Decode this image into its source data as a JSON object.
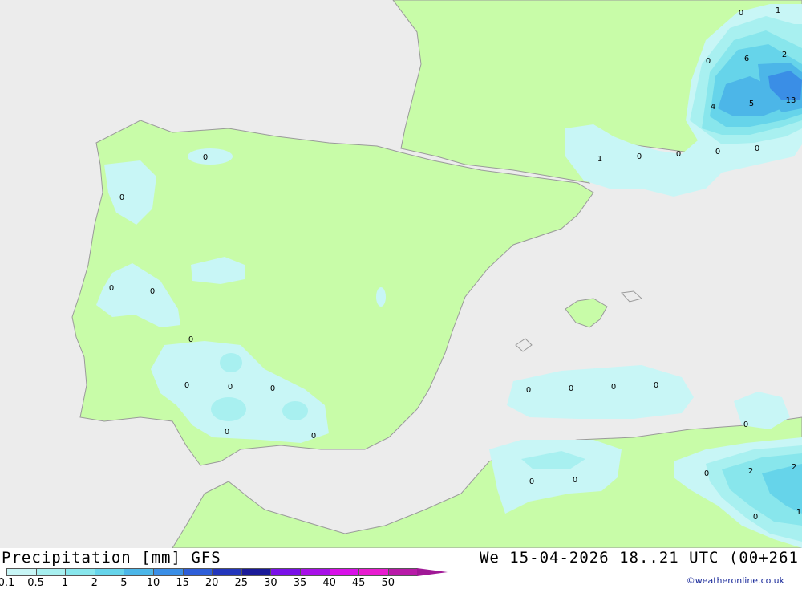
{
  "header": {
    "title": "Precipitation [mm] GFS",
    "run": "We 15-04-2026 18..21 UTC (00+261"
  },
  "legend": {
    "items": [
      {
        "label": "0.1",
        "color": "#c8f6f6"
      },
      {
        "label": "0.5",
        "color": "#a8f0f0"
      },
      {
        "label": "1",
        "color": "#88e6ec"
      },
      {
        "label": "2",
        "color": "#66d4ea"
      },
      {
        "label": "5",
        "color": "#4cb6e8"
      },
      {
        "label": "10",
        "color": "#3a8ee6"
      },
      {
        "label": "15",
        "color": "#2e5ed8"
      },
      {
        "label": "20",
        "color": "#2336bc"
      },
      {
        "label": "25",
        "color": "#1a1a98"
      },
      {
        "label": "30",
        "color": "#7a10e8"
      },
      {
        "label": "35",
        "color": "#a810e8"
      },
      {
        "label": "40",
        "color": "#d810e8"
      },
      {
        "label": "45",
        "color": "#e81cd0"
      },
      {
        "label": "50",
        "color": "#b81aa8"
      }
    ],
    "arrow_color": "#a01896"
  },
  "credit": "©weatheronline.co.uk",
  "colors": {
    "sea": "#ececec",
    "land": "#c8fca8",
    "border": "#9a9a9a"
  },
  "map_labels": {
    "values": [
      "1",
      "0",
      "6",
      "2",
      "0",
      "13",
      "4",
      "5",
      "0",
      "1",
      "0",
      "0",
      "0",
      "0",
      "0",
      "0",
      "0",
      "0",
      "0",
      "0",
      "0",
      "0",
      "0",
      "0",
      "0",
      "0",
      "0",
      "0",
      "0",
      "0",
      "0",
      "2",
      "2",
      "0",
      "1"
    ]
  }
}
